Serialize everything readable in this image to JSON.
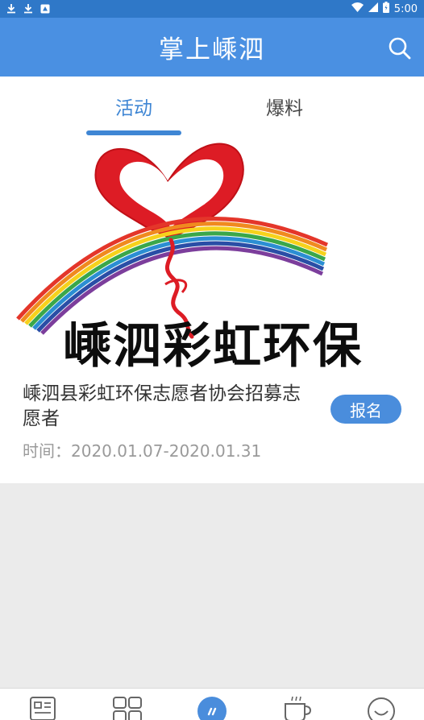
{
  "status_bar": {
    "time": "5:00",
    "left_icons": [
      "download-icon",
      "download-icon",
      "notification-icon"
    ],
    "right_icons": [
      "wifi-icon",
      "signal-icon",
      "battery-icon"
    ]
  },
  "app_bar": {
    "title": "掌上嵊泗",
    "search_icon": "search-icon"
  },
  "tabs": [
    {
      "label": "活动",
      "active": true
    },
    {
      "label": "爆料",
      "active": false
    }
  ],
  "activity": {
    "banner_text": "嵊泗彩虹环保",
    "title": "嵊泗县彩虹环保志愿者协会招募志愿者",
    "time": "时间：2020.01.07-2020.01.31",
    "signup_label": "报名"
  },
  "bottom_nav": {
    "items": [
      "news-icon",
      "grid-icon",
      "activity-icon",
      "cup-icon",
      "smile-icon"
    ],
    "active_index": 2
  },
  "colors": {
    "status_bar": "#2f78c8",
    "app_bar": "#4a90e2",
    "accent": "#3f86d4",
    "background": "#ebebeb"
  }
}
